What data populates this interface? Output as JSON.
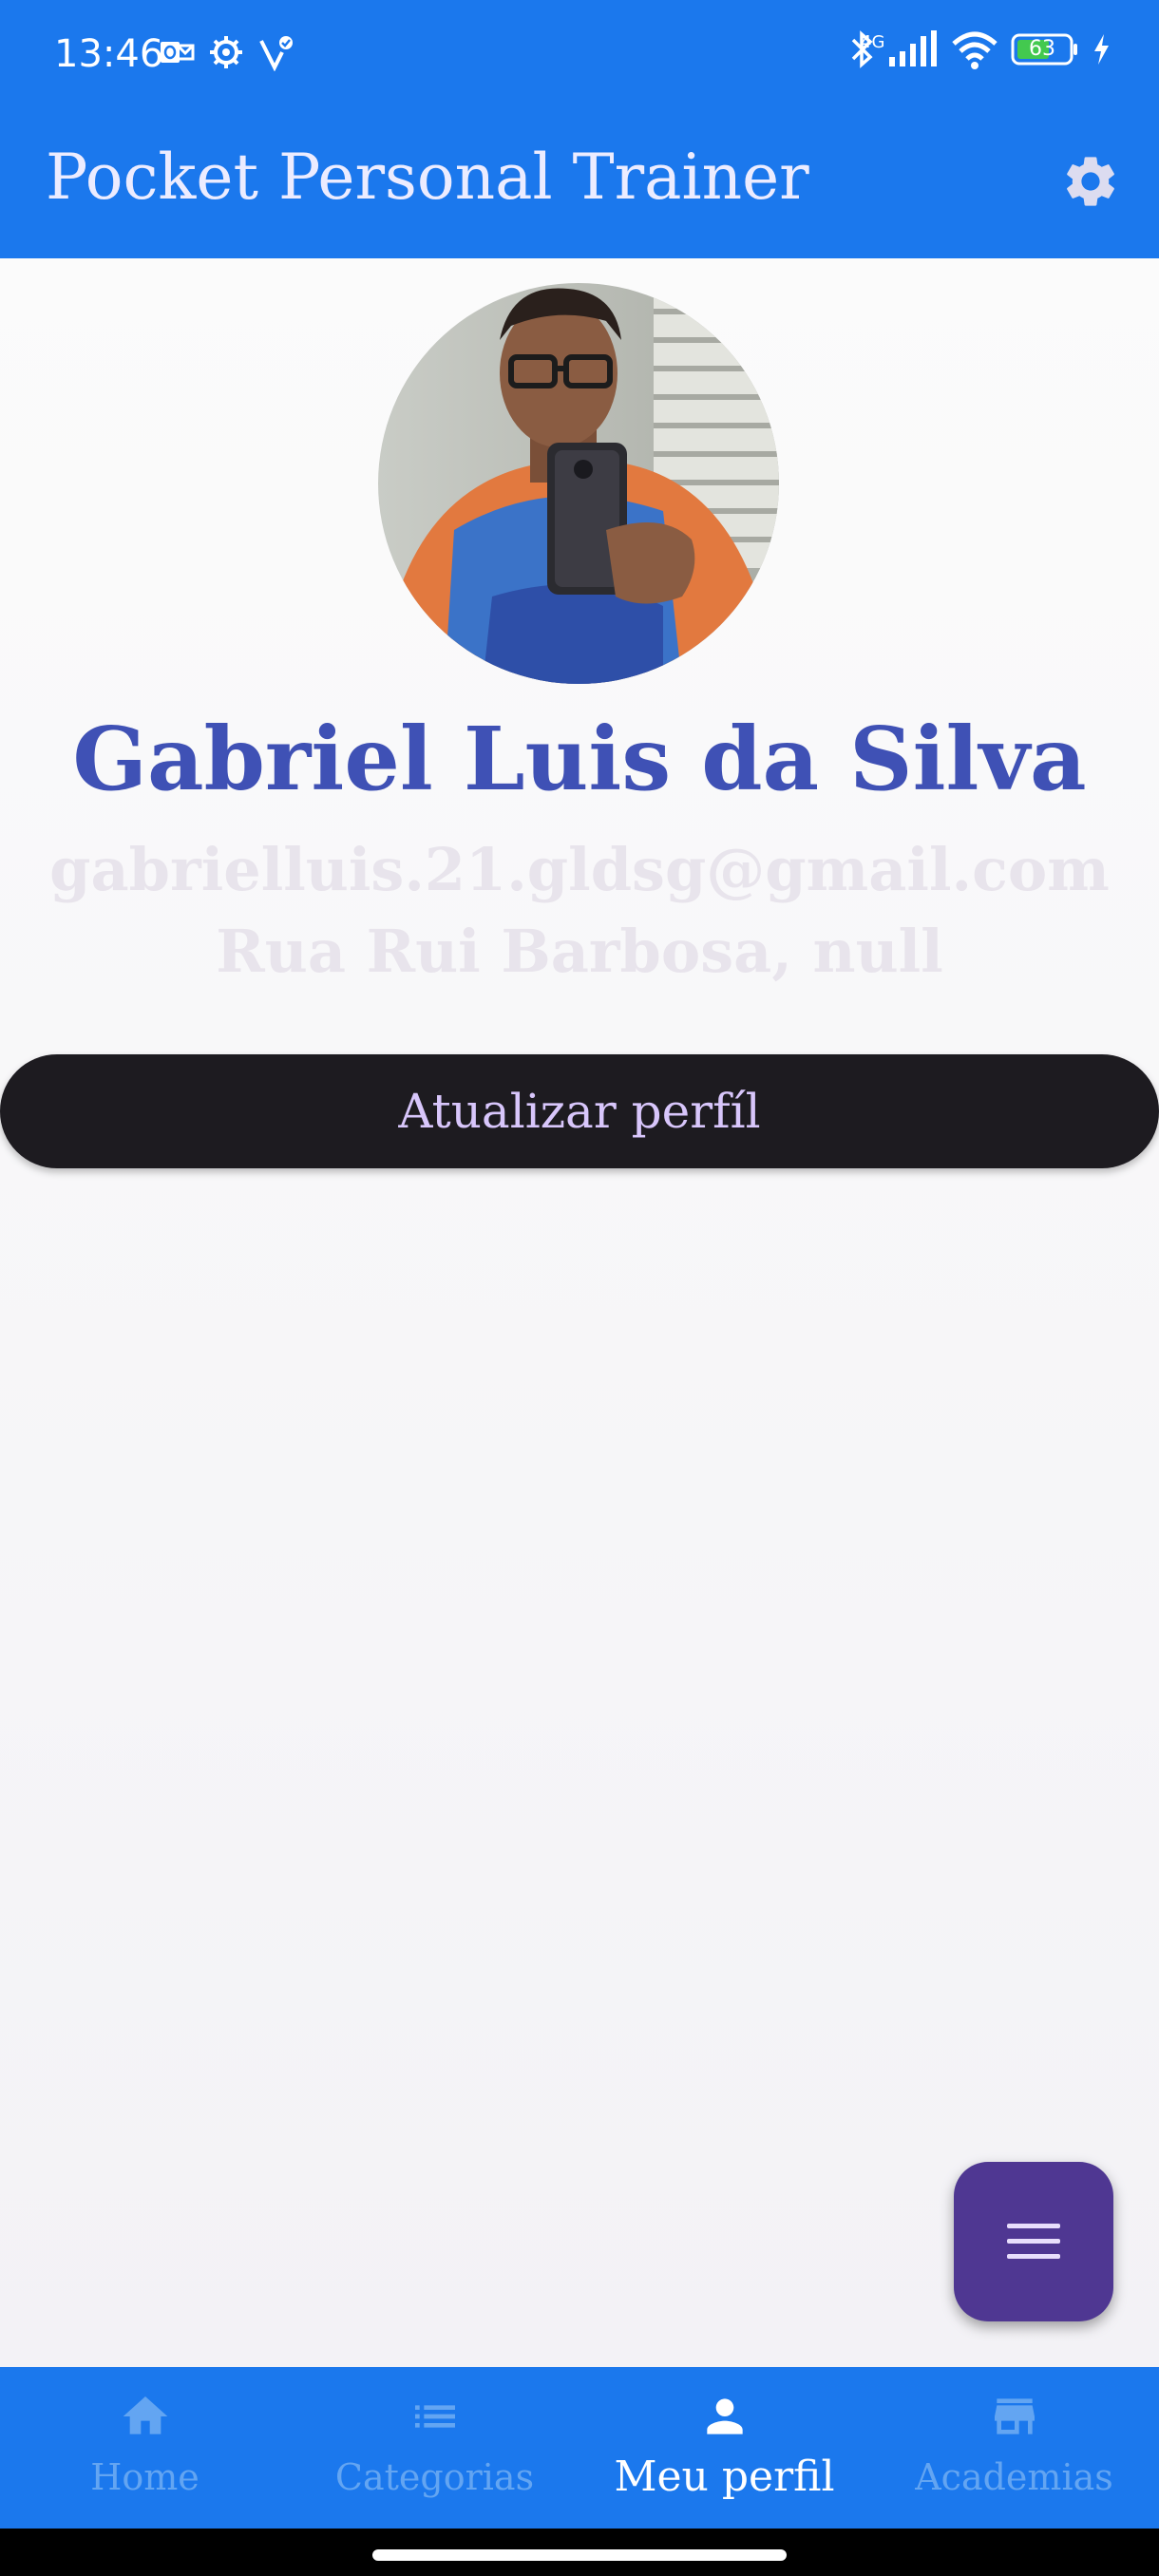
{
  "status_bar": {
    "time": "13:46",
    "network": "4G",
    "battery": "63",
    "left_icons": [
      "outlook-icon",
      "gear-cog-icon",
      "check-heart-icon"
    ],
    "right_icons": [
      "bluetooth-icon",
      "signal-icon",
      "wifi-icon",
      "battery-icon",
      "charging-icon"
    ]
  },
  "app_bar": {
    "title": "Pocket Personal Trainer",
    "settings_icon": "settings-gear-icon"
  },
  "profile": {
    "name": "Gabriel Luis da Silva",
    "email": "gabrielluis.21.gldsg@gmail.com",
    "address": "Rua Rui Barbosa, null",
    "update_button_label": "Atualizar perfíl"
  },
  "fab": {
    "icon": "menu-icon"
  },
  "bottom_nav": {
    "items": [
      {
        "label": "Home",
        "icon": "home-icon",
        "active": false
      },
      {
        "label": "Categorias",
        "icon": "list-icon",
        "active": false
      },
      {
        "label": "Meu perfil",
        "icon": "person-icon",
        "active": true
      },
      {
        "label": "Academias",
        "icon": "store-icon",
        "active": false
      }
    ]
  },
  "colors": {
    "primary": "#1b78ed",
    "name_text": "#3f51b5",
    "muted_text": "#e8e4ec",
    "button_bg": "#1d1b20",
    "button_text": "#d8c6fb",
    "fab_bg": "#4f3792",
    "nav_inactive": "#63a5f2",
    "nav_active": "#ffffff"
  }
}
